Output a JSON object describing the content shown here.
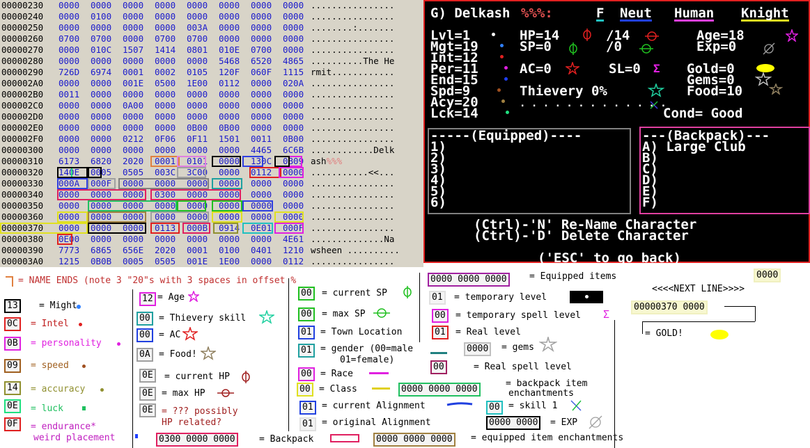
{
  "hex": {
    "rows": [
      {
        "off": "00000230",
        "w": [
          "0000",
          "0000",
          "0000",
          "0000",
          "0000",
          "0000",
          "0000",
          "0000"
        ],
        "asc": "................"
      },
      {
        "off": "00000240",
        "w": [
          "0000",
          "0100",
          "0000",
          "0000",
          "0000",
          "0000",
          "0000",
          "0000"
        ],
        "asc": "................"
      },
      {
        "off": "00000250",
        "w": [
          "0000",
          "0000",
          "0000",
          "0000",
          "003A",
          "0000",
          "0000",
          "0000"
        ],
        "asc": "........:......."
      },
      {
        "off": "00000260",
        "w": [
          "0700",
          "0700",
          "0000",
          "0700",
          "0700",
          "0000",
          "0000",
          "0000"
        ],
        "asc": "................"
      },
      {
        "off": "00000270",
        "w": [
          "0000",
          "010C",
          "1507",
          "1414",
          "0801",
          "010E",
          "0700",
          "0000"
        ],
        "asc": "................"
      },
      {
        "off": "00000280",
        "w": [
          "0000",
          "0000",
          "0000",
          "0000",
          "0000",
          "5468",
          "6520",
          "4865"
        ],
        "asc": "..........The He"
      },
      {
        "off": "00000290",
        "w": [
          "726D",
          "6974",
          "0001",
          "0002",
          "0105",
          "120F",
          "060F",
          "1115"
        ],
        "asc": "rmit............"
      },
      {
        "off": "000002A0",
        "w": [
          "0000",
          "0000",
          "001E",
          "0500",
          "1E00",
          "0112",
          "0000",
          "020A"
        ],
        "asc": "................"
      },
      {
        "off": "000002B0",
        "w": [
          "0011",
          "0000",
          "0000",
          "0000",
          "0000",
          "0000",
          "0000",
          "0000"
        ],
        "asc": "................"
      },
      {
        "off": "000002C0",
        "w": [
          "0000",
          "0000",
          "0A00",
          "0000",
          "0000",
          "0000",
          "0000",
          "0000"
        ],
        "asc": "................"
      },
      {
        "off": "000002D0",
        "w": [
          "0000",
          "0000",
          "0000",
          "0000",
          "0000",
          "0000",
          "0000",
          "0000"
        ],
        "asc": "................"
      },
      {
        "off": "000002E0",
        "w": [
          "0000",
          "0000",
          "0000",
          "0000",
          "0B00",
          "0B00",
          "0000",
          "0000"
        ],
        "asc": "................"
      },
      {
        "off": "000002F0",
        "w": [
          "0000",
          "0000",
          "0212",
          "0F06",
          "0F11",
          "1501",
          "0011",
          "0B00"
        ],
        "asc": "................"
      },
      {
        "off": "00000300",
        "w": [
          "0000",
          "0000",
          "0000",
          "0000",
          "0000",
          "0000",
          "4465",
          "6C6B"
        ],
        "asc": "............Delk"
      },
      {
        "off": "00000310",
        "w": [
          "6173",
          "6820",
          "2020",
          "0001",
          "0101",
          "0000",
          "130C",
          "0B09"
        ],
        "asc": "ash",
        "asc_pct": "%%%"
      },
      {
        "off": "00000320",
        "w": [
          "140E",
          "0005",
          "0505",
          "003C",
          "3C00",
          "0000",
          "0112",
          "0000"
        ],
        "asc": "...........<<..."
      },
      {
        "off": "00000330",
        "w": [
          "000A",
          "000F",
          "0000",
          "0000",
          "0000",
          "0000",
          "0000",
          "0000"
        ],
        "asc": "................"
      },
      {
        "off": "00000340",
        "w": [
          "0000",
          "0000",
          "0000",
          "0300",
          "0000",
          "0000",
          "0000",
          "0000"
        ],
        "asc": "................"
      },
      {
        "off": "00000350",
        "w": [
          "0000",
          "0000",
          "0000",
          "0000",
          "0000",
          "0000",
          "0000",
          "0000"
        ],
        "asc": "................"
      },
      {
        "off": "00000360",
        "w": [
          "0000",
          "0000",
          "0000",
          "0000",
          "0000",
          "0000",
          "0000",
          "0000"
        ],
        "asc": "................"
      },
      {
        "off": "00000370",
        "w": [
          "0000",
          "0000",
          "0000",
          "0113",
          "000B",
          "0914",
          "0E01",
          "000F"
        ],
        "asc": "................"
      },
      {
        "off": "00000380",
        "w": [
          "0E00",
          "0000",
          "0000",
          "0000",
          "0000",
          "0000",
          "0000",
          "4E61"
        ],
        "asc": "..............Na"
      },
      {
        "off": "00000390",
        "w": [
          "7773",
          "6865",
          "656E",
          "2020",
          "0001",
          "0100",
          "0401",
          "1210"
        ],
        "asc": "wsheen .........."
      },
      {
        "off": "000003A0",
        "w": [
          "1215",
          "0B0B",
          "0005",
          "0505",
          "001E",
          "1E00",
          "0000",
          "0112"
        ],
        "asc": "................"
      }
    ]
  },
  "game": {
    "header": {
      "prefix": "G) Delkash",
      "pcts": "%%%:",
      "gender": "F",
      "align": "Neut",
      "race": "Human",
      "cls": "Knight"
    },
    "stats": {
      "lvl": "Lvl=1",
      "mgt": "Mgt=19",
      "int": "Int=12",
      "per": "Per=11",
      "end": "End=15",
      "spd": "Spd=9",
      "acy": "Acy=20",
      "lck": "Lck=14",
      "hp": "HP=14",
      "hpmax": "/14",
      "sp": "SP=0",
      "spmax": "/0",
      "age": "Age=18",
      "exp": "Exp=0",
      "ac": "AC=0",
      "sl": "SL=0",
      "gold": "Gold=0",
      "gems": "Gems=0",
      "food": "Food=10",
      "thievery": "Thievery 0%",
      "dots": ". . . . . . . . . . . . .",
      "cond": "Cond= Good"
    },
    "equipped_title": "-----(Equipped)----",
    "equipped": [
      "1)",
      "2)",
      "3)",
      "4)",
      "5)",
      "6)"
    ],
    "backpack_title": "---(Backpack)---",
    "backpack": [
      "A) Large Club",
      "B)",
      "C)",
      "D)",
      "E)",
      "F)"
    ],
    "cmd_rename": "(Ctrl)-'N' Re-Name Character",
    "cmd_delete": "(Ctrl)-'D' Delete Character",
    "cmd_esc": "('ESC' to go back)"
  },
  "legend": {
    "name_ends": "= NAME ENDS (note 3 \"20\"s with 3 spaces in offset %",
    "might_chip": "13",
    "might": "= Might",
    "intel_chip": "0C",
    "intel": "= Intel",
    "pers_chip": "0B",
    "pers": "= personality",
    "speed_chip": "09",
    "speed": "= speed",
    "acc_chip": "14",
    "acc": "= accuracy",
    "luck_chip": "0E",
    "luck": "= luck",
    "end_chip": "0F",
    "end": "= endurance*",
    "end2": "weird placement",
    "age_chip": "12",
    "age": "= Age",
    "thiev_chip": "00",
    "thiev": "= Thievery skill",
    "ac_chip": "00",
    "ac": "= AC",
    "food_chip": "0A",
    "food": "= Food!",
    "chp_chip": "0E",
    "chp": "= current HP",
    "mhp_chip": "0E",
    "mhp": "= max HP",
    "unk_chip": "0E",
    "unk": "= ??? possibly",
    "unk2": "HP related?",
    "backpack_chip": "0300 0000 0000",
    "backpack": "= Backpack",
    "csp_chip": "00",
    "csp": "= current SP",
    "msp_chip": "00",
    "msp": "= max SP",
    "town_chip": "01",
    "town": "= Town Location",
    "gender_chip": "01",
    "gender": "= gender (00=male",
    "gender2": "01=female)",
    "race_chip": "00",
    "race": "= Race",
    "class_chip": "00",
    "class": "= Class",
    "calign_chip": "01",
    "calign": "= current Alignment",
    "oalign_chip": "01",
    "oalign": "= original Alignment",
    "eq_chip": "0000 0000 0000",
    "eq": "= Equipped items",
    "tlvl_chip": "01",
    "tlvl": "= temporary level",
    "tspl_chip": "00",
    "tspl": "= temporary spell level",
    "rlvl_chip": "01",
    "rlvl": "= Real level",
    "gems_chip": "0000",
    "gems": "= gems",
    "rspl_chip": "00",
    "rspl": "= Real spell level",
    "bpe_chip": "0000 0000 0000",
    "bpe": "= backpack item",
    "bpe2": "enchantments",
    "skill_chip": "00",
    "skill": "= skill 1",
    "exp_chip": "0000 0000",
    "exp": "= EXP",
    "eqe_chip": "0000 0000 0000",
    "eqe": "= equipped item enchantments",
    "next_chip": "0000",
    "next": "<<<<NEXT LINE>>>>",
    "gold_chip": "00000370 0000",
    "gold": "= GOLD!"
  },
  "colors": {
    "hexblue": "#1a1acc",
    "red": "#e02020",
    "teal": "#20a0a0",
    "magenta": "#e020e0"
  }
}
